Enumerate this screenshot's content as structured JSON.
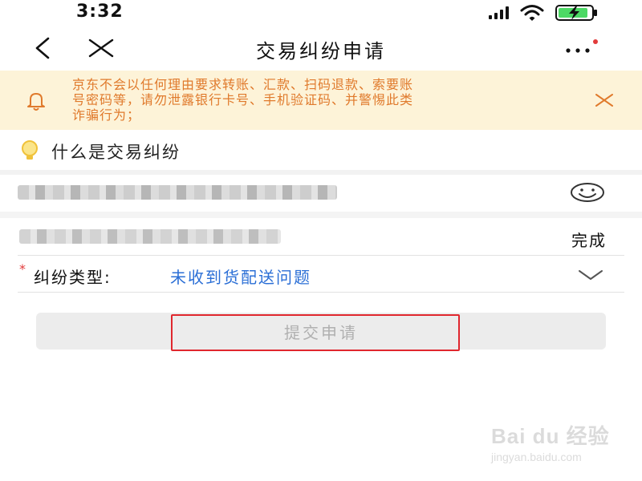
{
  "status_bar": {
    "time": "3:32",
    "icons": [
      "cellular-signal-icon",
      "wifi-icon",
      "battery-charging-icon"
    ],
    "battery_color": "#4cd964"
  },
  "nav": {
    "title": "交易纠纷申请",
    "icons": [
      "back-arrow-icon",
      "close-icon",
      "more-icon"
    ],
    "more_badge_color": "#e23b3b"
  },
  "notice": {
    "lines": [
      "京东不会以任何理由要求转账、汇款、扫码退款、索要账",
      "号密码等，请勿泄露银行卡号、手机验证码、并警惕此类",
      "诈骗行为；"
    ],
    "text_color": "#e07a2c",
    "background": "#fdf3d8",
    "icons": [
      "bell-icon",
      "close-icon"
    ]
  },
  "faq": {
    "label": "什么是交易纠纷",
    "icon": "lightbulb-icon"
  },
  "order_row": {
    "icon": "chat-bubble-icon"
  },
  "item_row": {
    "done_label": "完成"
  },
  "dispute_type": {
    "required_mark": "*",
    "label": "纠纷类型:",
    "value": "未收到货配送问题",
    "value_color": "#2b6fd6",
    "icon": "chevron-down-icon"
  },
  "submit": {
    "label": "提交申请",
    "highlight_color": "#e0272e"
  },
  "watermark": {
    "main": "Bai du 经验",
    "sub": "jingyan.baidu.com"
  }
}
